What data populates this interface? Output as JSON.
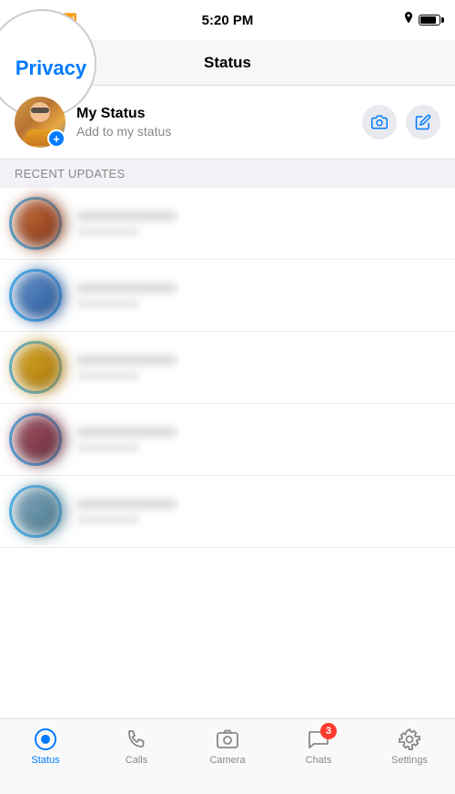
{
  "statusBar": {
    "time": "5:20 PM",
    "battery": "full"
  },
  "header": {
    "title": "Status",
    "privacyLabel": "Privacy"
  },
  "myStatus": {
    "name": "My Status",
    "subtitle": "Add to my status",
    "cameraAlt": "Camera",
    "editAlt": "Edit"
  },
  "recentUpdates": {
    "sectionLabel": "RECENT UPDATES"
  },
  "tabBar": {
    "tabs": [
      {
        "id": "status",
        "label": "Status",
        "active": true,
        "badge": null
      },
      {
        "id": "calls",
        "label": "Calls",
        "active": false,
        "badge": null
      },
      {
        "id": "camera",
        "label": "Camera",
        "active": false,
        "badge": null
      },
      {
        "id": "chats",
        "label": "Chats",
        "active": false,
        "badge": "3"
      },
      {
        "id": "settings",
        "label": "Settings",
        "active": false,
        "badge": null
      }
    ]
  }
}
